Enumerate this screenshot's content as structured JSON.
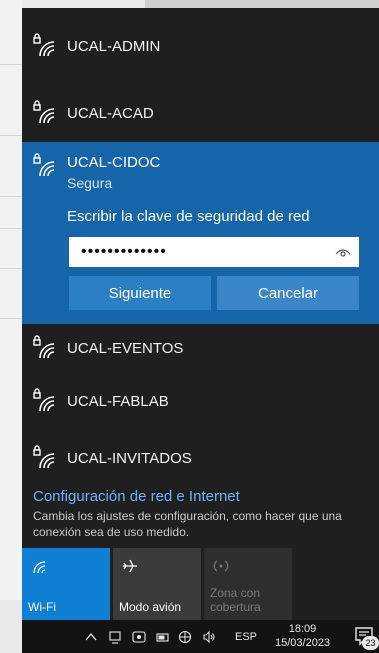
{
  "networks_top": [
    {
      "name": "UCAL-ADMIN"
    },
    {
      "name": "UCAL-ACAD"
    }
  ],
  "active_network": {
    "name": "UCAL-CIDOC",
    "status": "Segura",
    "prompt": "Escribir la clave de seguridad de red",
    "password_value": "•••••••••••••",
    "next_label": "Siguiente",
    "cancel_label": "Cancelar"
  },
  "networks_bottom": [
    {
      "name": "UCAL-EVENTOS"
    },
    {
      "name": "UCAL-FABLAB"
    },
    {
      "name": "UCAL-INVITADOS"
    }
  ],
  "settings": {
    "title": "Configuración de red e Internet",
    "description": "Cambia los ajustes de configuración, como hacer que una conexión sea de uso medido."
  },
  "tiles": [
    {
      "label": "Wi-Fi",
      "state": "on",
      "icon": "wifi-icon"
    },
    {
      "label": "Modo avión",
      "state": "off",
      "icon": "airplane-icon"
    },
    {
      "label": "Zona con cobertura",
      "state": "disabled",
      "icon": "hotspot-icon"
    }
  ],
  "taskbar": {
    "language": "ESP",
    "time": "18:09",
    "date": "15/03/2023",
    "notification_count": "23"
  },
  "colors": {
    "accent": "#1565a8",
    "panel": "#1f1f1f",
    "link": "#6fb1ff"
  }
}
